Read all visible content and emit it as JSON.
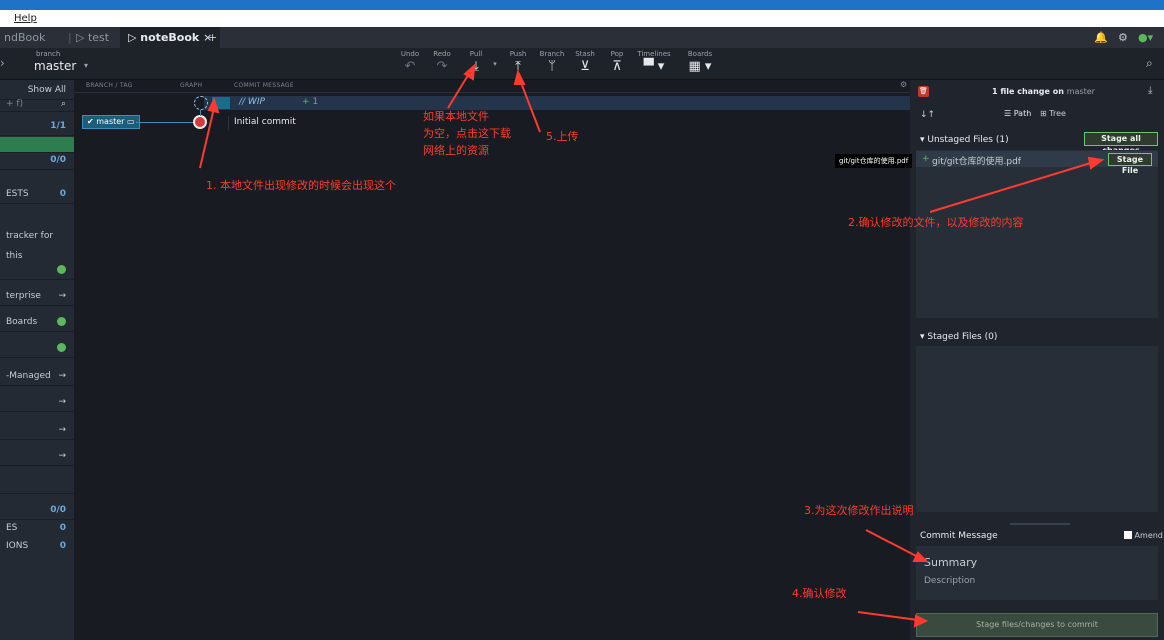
{
  "menubar": {
    "help": "Help"
  },
  "tabs": [
    {
      "label": "ndBook",
      "active": false
    },
    {
      "label": "test",
      "active": false
    },
    {
      "label": "noteBook",
      "active": true
    }
  ],
  "tab_close": "×",
  "tab_add": "+",
  "toolbar": {
    "branch_caption": "branch",
    "branch_name": "master",
    "undo": "Undo",
    "redo": "Redo",
    "pull": "Pull",
    "push": "Push",
    "branch": "Branch",
    "stash": "Stash",
    "pop": "Pop",
    "timelines": "Timelines",
    "boards": "Boards"
  },
  "left": {
    "show_all": "Show All",
    "filter_placeholder": "+ f)",
    "count1": "1/1",
    "count2": "0/0",
    "pull_requests": "ESTS",
    "pull_requests_count": "0",
    "issue_tracker": "tracker for this",
    "enterprise": "terprise",
    "boards": "Boards",
    "managed": "-Managed",
    "count3": "0/0",
    "sub1": "ES",
    "sub1_count": "0",
    "sub2": "IONS",
    "sub2_count": "0"
  },
  "graph": {
    "col_branch": "BRANCH / TAG",
    "col_graph": "GRAPH",
    "col_message": "COMMIT MESSAGE",
    "wip_label": "// WIP",
    "wip_count": "+ 1",
    "branch_label": "master",
    "commit_message": "Initial commit"
  },
  "right": {
    "summary_prefix": "1 file change on",
    "summary_branch": "master",
    "path_label": "Path",
    "tree_label": "Tree",
    "unstaged_title": "Unstaged Files (1)",
    "stage_all": "Stage all changes",
    "file_name": "git/git仓库的使用.pdf",
    "stage_file": "Stage File",
    "tooltip": "git/git仓库的使用.pdf",
    "staged_title": "Staged Files (0)",
    "commit_title": "Commit Message",
    "amend": "Amend",
    "summary_placeholder": "Summary",
    "description_placeholder": "Description",
    "commit_button": "Stage files/changes to commit"
  },
  "annotations": {
    "a1": "1. 本地文件出现修改的时候会出现这个",
    "a_pull_1": "如果本地文件",
    "a_pull_2": "为空，点击这下载",
    "a_pull_3": "网络上的资源",
    "a5": "5.上传",
    "a2": "2.确认修改的文件，以及修改的内容",
    "a3": "3.为这次修改作出说明",
    "a4": "4.确认修改"
  },
  "colors": {
    "accent": "#1e73c8",
    "stage_green": "#6ec56e",
    "annotation": "#ff3b2f"
  }
}
